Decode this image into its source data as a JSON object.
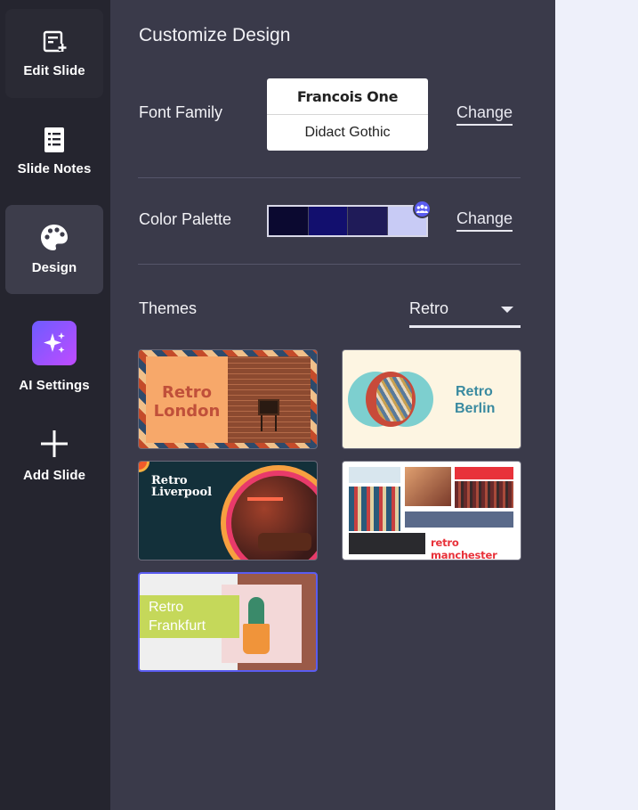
{
  "sidebar": {
    "items": [
      {
        "label": "Edit Slide",
        "icon": "edit-slide-icon"
      },
      {
        "label": "Slide Notes",
        "icon": "notes-icon"
      },
      {
        "label": "Design",
        "icon": "palette-icon",
        "active": true
      },
      {
        "label": "AI Settings",
        "icon": "sparkle-icon"
      },
      {
        "label": "Add Slide",
        "icon": "plus-icon"
      }
    ]
  },
  "panel": {
    "title": "Customize Design",
    "font_family": {
      "label": "Font Family",
      "heading_font": "Francois One",
      "body_font": "Didact Gothic",
      "change_label": "Change"
    },
    "color_palette": {
      "label": "Color Palette",
      "colors": [
        "#0b0930",
        "#120f6e",
        "#1f1b58",
        "#c8cbf5"
      ],
      "change_label": "Change"
    },
    "themes": {
      "label": "Themes",
      "selected_value": "Retro",
      "items": [
        {
          "name": "Retro London",
          "title_line1": "Retro",
          "title_line2": "London"
        },
        {
          "name": "Retro Berlin",
          "title_line1": "Retro",
          "title_line2": "Berlin"
        },
        {
          "name": "Retro Liverpool",
          "title_line1": "Retro",
          "title_line2": "Liverpool"
        },
        {
          "name": "retro manchester",
          "title_line1": "retro manchester",
          "title_line2": ""
        },
        {
          "name": "Retro Frankfurt",
          "title_line1": "Retro",
          "title_line2": "Frankfurt",
          "selected": true
        }
      ]
    }
  },
  "colors": {
    "sidebar_bg": "#25252f",
    "panel_bg": "#3a3a4a",
    "accent": "#5a5cf0"
  }
}
